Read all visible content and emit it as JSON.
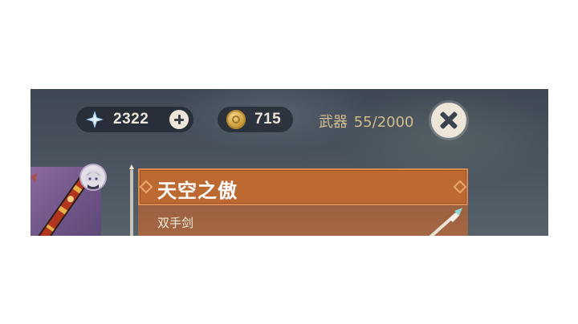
{
  "currency": {
    "primogems": "2322",
    "mora": "715"
  },
  "inventory": {
    "category_label": "武器",
    "count": "55/2000"
  },
  "selected_weapon": {
    "name": "天空之傲",
    "type": "双手剑"
  },
  "colors": {
    "title_bar": "#bd6932",
    "capacity_text": "#d3bc8e",
    "card_bg": "#7a5a92"
  },
  "icons": {
    "primogem": "primogem-star-icon",
    "mora": "mora-coin-icon",
    "add": "plus-icon",
    "close": "close-icon"
  }
}
